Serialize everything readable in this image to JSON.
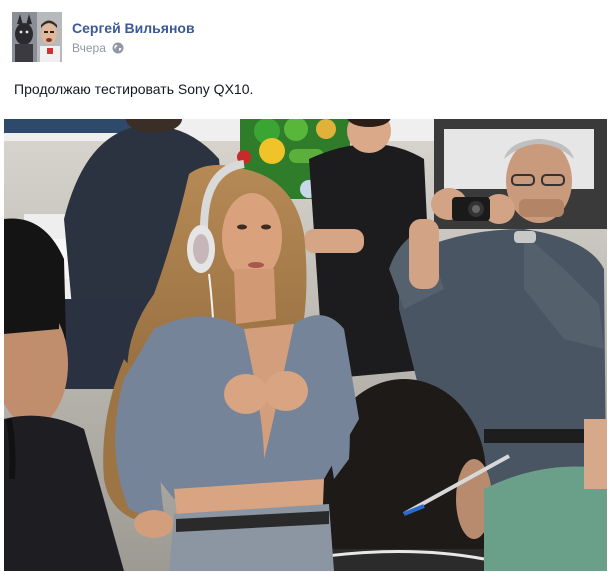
{
  "post": {
    "author": {
      "name": "Сергей Вильянов",
      "avatar_icon": "user-avatar"
    },
    "timestamp": "Вчера",
    "privacy_icon": "globe-icon",
    "text": "Продолжаю тестировать Sony QX10.",
    "photo": {
      "description_icon": "photo-image"
    }
  },
  "colors": {
    "author_link": "#3b5998",
    "meta_text": "#9197a3",
    "body_text": "#141823"
  }
}
